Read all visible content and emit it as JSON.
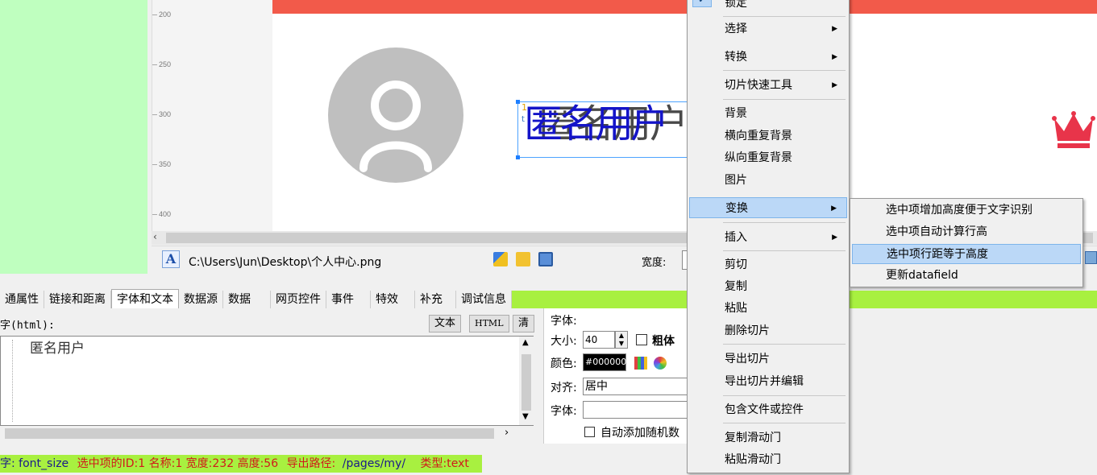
{
  "ruler": {
    "labels": [
      "200",
      "250",
      "300",
      "350",
      "400"
    ]
  },
  "canvas": {
    "name_text": "匿名用户",
    "sel_num": "1",
    "sel_tag": "t"
  },
  "path_bar": {
    "path": "C:\\Users\\Jun\\Desktop\\个人中心.png",
    "width_label": "宽度:"
  },
  "tabs": [
    "通属性",
    "链接和距离",
    "字体和文本",
    "数据源",
    "数据",
    "网页控件",
    "事件",
    "特效",
    "补充",
    "调试信息"
  ],
  "active_tab": "字体和文本",
  "editor": {
    "label": "字(html):",
    "btn_text": "文本",
    "btn_html": "HTML",
    "btn_clear": "清",
    "content": "匿名用户"
  },
  "font_panel": {
    "header": "字体:",
    "size_label": "大小:",
    "size_value": "40",
    "bold_label": "粗体",
    "color_label": "颜色:",
    "color_value": "#000000",
    "align_label": "对齐:",
    "align_value": "居中",
    "font_label": "字体:",
    "font_value": "",
    "random_label": "自动添加随机数"
  },
  "status": {
    "key": "字: font_size",
    "selected": "选中项的ID:1 名称:1 宽度:232 高度:56",
    "export_label": "导出路径:",
    "export_path": "/pages/my/",
    "type": "类型:text"
  },
  "context_menu": {
    "items": [
      {
        "label": "锁定",
        "checked": true
      },
      {
        "label": "选择",
        "submenu": true
      },
      {
        "label": "转换",
        "submenu": true
      },
      {
        "label": "切片快速工具",
        "submenu": true
      },
      {
        "label": "背景"
      },
      {
        "label": "横向重复背景"
      },
      {
        "label": "纵向重复背景"
      },
      {
        "label": "图片"
      },
      {
        "label": "变换",
        "submenu": true,
        "highlighted": true
      },
      {
        "label": "插入",
        "submenu": true
      },
      {
        "label": "剪切"
      },
      {
        "label": "复制"
      },
      {
        "label": "粘贴"
      },
      {
        "label": "删除切片"
      },
      {
        "label": "导出切片"
      },
      {
        "label": "导出切片并编辑"
      },
      {
        "label": "包含文件或控件"
      },
      {
        "label": "复制滑动门"
      },
      {
        "label": "粘贴滑动门"
      }
    ]
  },
  "submenu": {
    "items": [
      {
        "label": "选中项增加高度便于文字识别"
      },
      {
        "label": "选中项自动计算行高"
      },
      {
        "label": "选中项行距等于高度",
        "highlighted": true
      },
      {
        "label": "更新datafield"
      }
    ]
  },
  "colors": {
    "left_panel": "#bfffbf",
    "canvas_header": "#f25a4a",
    "status_green": "#a8f040",
    "menu_highlight": "#bbd8f7",
    "name_text": "#1414c8"
  },
  "icons": [
    "text-layer-icon",
    "marker-icon",
    "folder-icon",
    "save-icon",
    "color-grid-icon",
    "color-wheel-icon",
    "user-avatar-icon",
    "crown-icon"
  ]
}
